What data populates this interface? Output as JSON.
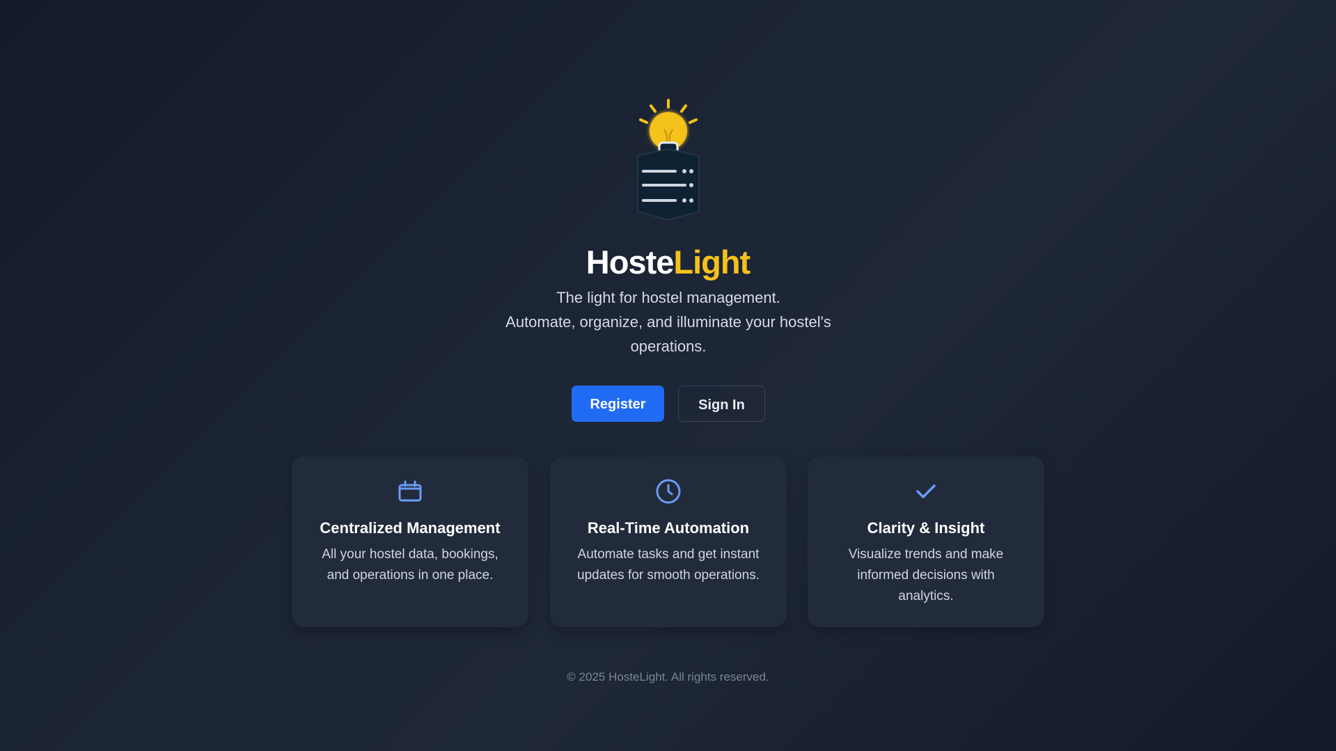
{
  "brand": {
    "name_part1": "Hoste",
    "name_part2": "Light",
    "colors": {
      "primary": "#ffffff",
      "accent": "#f5c21b"
    }
  },
  "logo": {
    "icon": "lightbulb-server-icon"
  },
  "tagline": {
    "line1": "The light for hostel management.",
    "line2": "Automate, organize, and illuminate your hostel's operations."
  },
  "actions": {
    "register_label": "Register",
    "signin_label": "Sign In",
    "register_color": "#1f6bf3"
  },
  "features": [
    {
      "icon": "calendar-icon",
      "title": "Centralized Management",
      "description": "All your hostel data, bookings, and operations in one place."
    },
    {
      "icon": "clock-icon",
      "title": "Real-Time Automation",
      "description": "Automate tasks and get instant updates for smooth operations."
    },
    {
      "icon": "checkmark-icon",
      "title": "Clarity & Insight",
      "description": "Visualize trends and make informed decisions with analytics."
    }
  ],
  "footer": {
    "copyright": "© 2025 HosteLight. All rights reserved."
  }
}
